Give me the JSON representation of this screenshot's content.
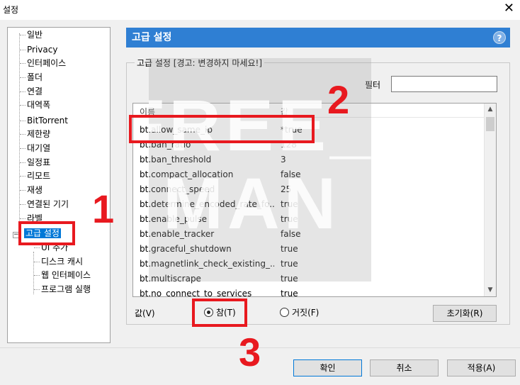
{
  "window": {
    "title": "설정",
    "close_glyph": "✕"
  },
  "sidebar": {
    "items": [
      {
        "label": "일반"
      },
      {
        "label": "Privacy"
      },
      {
        "label": "인터페이스"
      },
      {
        "label": "폴더"
      },
      {
        "label": "연결"
      },
      {
        "label": "대역폭"
      },
      {
        "label": "BitTorrent"
      },
      {
        "label": "제한량"
      },
      {
        "label": "대기열"
      },
      {
        "label": "일정표"
      },
      {
        "label": "리모트"
      },
      {
        "label": "재생"
      },
      {
        "label": "연결된 기기"
      },
      {
        "label": "라벨"
      },
      {
        "label": "고급 설정",
        "selected": true
      },
      {
        "label": "UI 추가"
      },
      {
        "label": "디스크 캐시"
      },
      {
        "label": "웹 인터페이스"
      },
      {
        "label": "프로그램 실행"
      }
    ]
  },
  "panel": {
    "header": "고급 설정",
    "help_glyph": "?",
    "group_title": "고급 설정 [경고: 변경하지 마세요!]",
    "filter_label": "필터",
    "filter_value": "",
    "columns": {
      "name": "이름",
      "value": "값"
    },
    "rows": [
      {
        "name": "bt.allow_same_ip",
        "value": "*true"
      },
      {
        "name": "bt.ban_ratio",
        "value": "128"
      },
      {
        "name": "bt.ban_threshold",
        "value": "3"
      },
      {
        "name": "bt.compact_allocation",
        "value": "false"
      },
      {
        "name": "bt.connect_speed",
        "value": "25"
      },
      {
        "name": "bt.determine_encoded_rate_fo...",
        "value": "true"
      },
      {
        "name": "bt.enable_pulse",
        "value": "true"
      },
      {
        "name": "bt.enable_tracker",
        "value": "false"
      },
      {
        "name": "bt.graceful_shutdown",
        "value": "true"
      },
      {
        "name": "bt.magnetlink_check_existing_...",
        "value": "true"
      },
      {
        "name": "bt.multiscrape",
        "value": "true"
      },
      {
        "name": "bt.no_connect_to_services",
        "value": "true"
      }
    ],
    "value_label": "값(V)",
    "radio_true": "참(T)",
    "radio_false": "거짓(F)",
    "radio_selected": "true",
    "reset_button": "초기화(R)"
  },
  "footer": {
    "ok": "확인",
    "cancel": "취소",
    "apply": "적용(A)"
  },
  "annotations": {
    "one": "1",
    "two": "2",
    "three": "3",
    "color": "#e8191f"
  },
  "watermark": {
    "line1": "FREE_",
    "line2": "MAN"
  }
}
